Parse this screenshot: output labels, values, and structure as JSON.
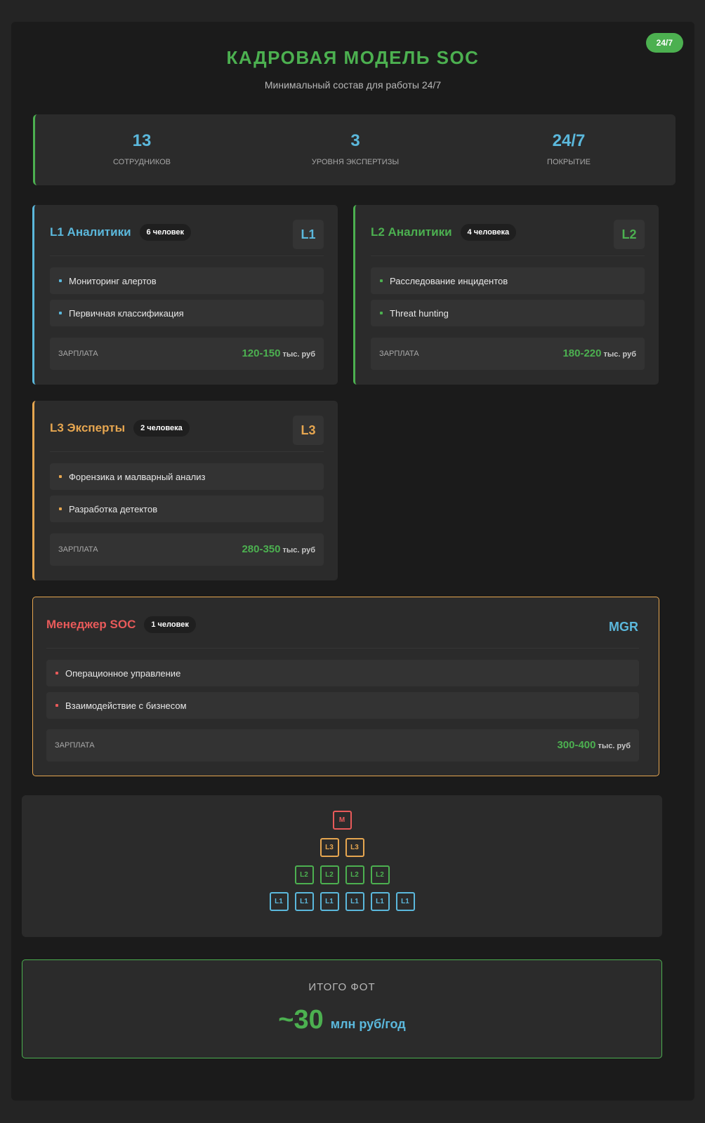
{
  "header": {
    "badge": "24/7",
    "title": "КАДРОВАЯ МОДЕЛЬ SOC",
    "subtitle": "Минимальный состав для работы 24/7"
  },
  "stats": [
    {
      "value": "13",
      "label": "СОТРУДНИКОВ"
    },
    {
      "value": "3",
      "label": "УРОВНЯ ЭКСПЕРТИЗЫ"
    },
    {
      "value": "24/7",
      "label": "ПОКРЫТИЕ"
    }
  ],
  "cards": {
    "l1": {
      "name": "L1 Аналитики",
      "count": "6 человек",
      "tag": "L1",
      "color": "#5bb8dc",
      "duties": [
        "Мониторинг алертов",
        "Первичная классификация"
      ],
      "salary_label": "ЗАРПЛАТА",
      "salary": "120-150",
      "salary_unit": "тыс. руб"
    },
    "l2": {
      "name": "L2 Аналитики",
      "count": "4 человека",
      "tag": "L2",
      "color": "#4cb050",
      "duties": [
        "Расследование инцидентов",
        "Threat hunting"
      ],
      "salary_label": "ЗАРПЛАТА",
      "salary": "180-220",
      "salary_unit": "тыс. руб"
    },
    "l3": {
      "name": "L3 Эксперты",
      "count": "2 человека",
      "tag": "L3",
      "color": "#e6a650",
      "duties": [
        "Форензика и малварный анализ",
        "Разработка детектов"
      ],
      "salary_label": "ЗАРПЛАТА",
      "salary": "280-350",
      "salary_unit": "тыс. руб"
    },
    "mgr": {
      "name": "Менеджер SOC",
      "count": "1 человек",
      "tag": "MGR",
      "color": "#e85a5a",
      "tag_color": "#5bb8dc",
      "duties": [
        "Операционное управление",
        "Взаимодействие с бизнесом"
      ],
      "salary_label": "ЗАРПЛАТА",
      "salary": "300-400",
      "salary_unit": "тыс. руб"
    }
  },
  "pyramid": {
    "rows": [
      {
        "labels": [
          "M"
        ],
        "color": "#e85a5a"
      },
      {
        "labels": [
          "L3",
          "L3"
        ],
        "color": "#e6a650"
      },
      {
        "labels": [
          "L2",
          "L2",
          "L2",
          "L2"
        ],
        "color": "#4cb050"
      },
      {
        "labels": [
          "L1",
          "L1",
          "L1",
          "L1",
          "L1",
          "L1"
        ],
        "color": "#5bb8dc"
      }
    ]
  },
  "total": {
    "label": "ИТОГО ФОТ",
    "value": "~30",
    "unit": "млн руб/год"
  }
}
